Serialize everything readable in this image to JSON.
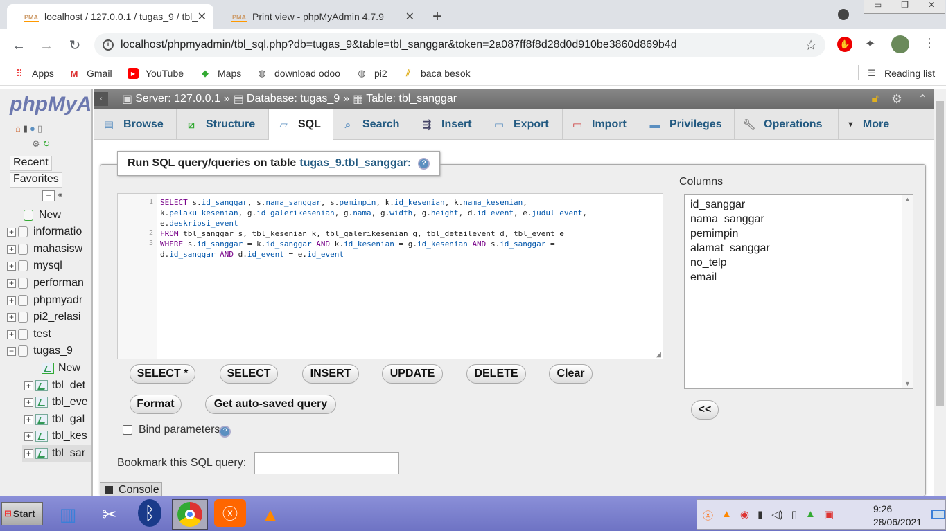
{
  "browser": {
    "tabs": [
      {
        "title": "localhost / 127.0.0.1 / tugas_9 / tbl_",
        "close": "✕"
      },
      {
        "title": "Print view - phpMyAdmin 4.7.9",
        "close": "✕"
      }
    ],
    "new_tab": "+",
    "url": "localhost/phpmyadmin/tbl_sql.php?db=tugas_9&table=tbl_sanggar&token=2a087ff8f8d28d0d910be3860d869b4d",
    "bookmarks": [
      "Apps",
      "Gmail",
      "YouTube",
      "Maps",
      "download odoo",
      "pi2",
      "baca besok"
    ],
    "reading_list": "Reading list"
  },
  "sidebar": {
    "logo": "phpMyA",
    "recent": "Recent",
    "favorites": "Favorites",
    "items": [
      "New",
      "informatio",
      "mahasisw",
      "mysql",
      "performan",
      "phpmyadr",
      "pi2_relasi",
      "test",
      "tugas_9"
    ],
    "sub_items": [
      "New",
      "tbl_det",
      "tbl_eve",
      "tbl_gal",
      "tbl_kes",
      "tbl_sar"
    ]
  },
  "breadcrumb": {
    "server": "Server: 127.0.0.1",
    "database": "Database: tugas_9",
    "table": "Table: tbl_sanggar",
    "sep": "»"
  },
  "tabs": [
    "Browse",
    "Structure",
    "SQL",
    "Search",
    "Insert",
    "Export",
    "Import",
    "Privileges",
    "Operations",
    "More"
  ],
  "active_tab": "SQL",
  "query_panel": {
    "legend": "Run SQL query/queries on table",
    "table_name": "tugas_9.tbl_sanggar:",
    "line_numbers": [
      "1",
      "2",
      "3"
    ],
    "buttons": [
      "SELECT *",
      "SELECT",
      "INSERT",
      "UPDATE",
      "DELETE",
      "Clear"
    ],
    "format": "Format",
    "autosaved": "Get auto-saved query",
    "bind_params": "Bind parameters",
    "bookmark_label": "Bookmark this SQL query:",
    "console": "Console"
  },
  "sql_lines": [
    "SELECT s.id_sanggar, s.nama_sanggar, s.pemimpin, k.id_kesenian, k.nama_kesenian,",
    "k.pelaku_kesenian, g.id_galerikesenian, g.nama, g.width, g.height, d.id_event, e.judul_event,",
    "e.deskripsi_event",
    "FROM tbl_sanggar s, tbl_kesenian k, tbl_galerikesenian g, tbl_detailevent d, tbl_event e",
    "WHERE s.id_sanggar = k.id_sanggar AND k.id_kesenian = g.id_kesenian AND s.id_sanggar =",
    "d.id_sanggar AND d.id_event = e.id_event"
  ],
  "columns_panel": {
    "label": "Columns",
    "items": [
      "id_sanggar",
      "nama_sanggar",
      "pemimpin",
      "alamat_sanggar",
      "no_telp",
      "email"
    ],
    "insert_btn": "<<"
  },
  "taskbar": {
    "start": "Start",
    "time": "9:26",
    "date": "28/06/2021"
  }
}
